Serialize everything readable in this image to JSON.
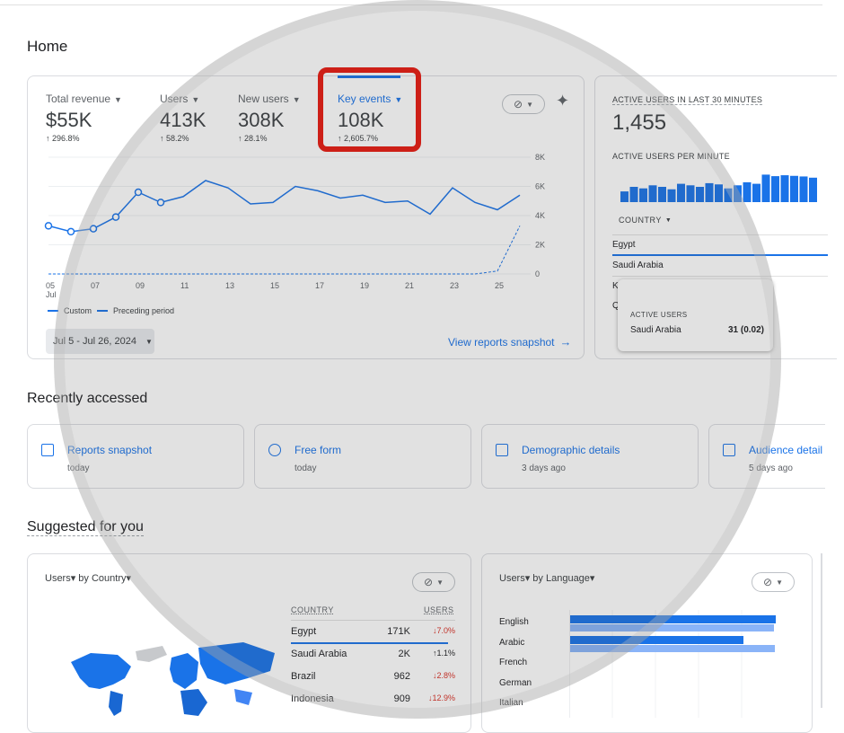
{
  "page": {
    "title": "Home"
  },
  "overview": {
    "metrics": [
      {
        "label": "Total revenue",
        "value": "$55K",
        "delta": "↑ 296.8%"
      },
      {
        "label": "Users",
        "value": "413K",
        "delta": "↑ 58.2%"
      },
      {
        "label": "New users",
        "value": "308K",
        "delta": "↑ 28.1%"
      },
      {
        "label": "Key events",
        "value": "108K",
        "delta": "↑ 2,605.7%"
      }
    ],
    "compare_label": "⊘",
    "y_ticks": [
      "8K",
      "6K",
      "4K",
      "2K",
      "0"
    ],
    "x_ticks": [
      "05",
      "07",
      "09",
      "11",
      "13",
      "15",
      "17",
      "19",
      "21",
      "23",
      "25"
    ],
    "x_month": "Jul",
    "legend_custom": "Custom",
    "legend_preceding": "Preceding period",
    "date_range": "Jul 5 - Jul 26, 2024",
    "view_snapshot": "View reports snapshot",
    "accent_color": "#1a73e8",
    "highlight_color": "#e8190f"
  },
  "realtime": {
    "title": "ACTIVE USERS IN LAST 30 MINUTES",
    "value": "1,455",
    "per_minute": "ACTIVE USERS PER MINUTE",
    "country_header": "COUNTRY",
    "countries": [
      "Egypt",
      "Saudi Arabia",
      "K",
      "Q"
    ],
    "tooltip_title": "ACTIVE USERS",
    "tooltip_country": "Saudi Arabia",
    "tooltip_value": "31 (0.02)",
    "bars": [
      0.35,
      0.5,
      0.45,
      0.55,
      0.5,
      0.42,
      0.6,
      0.55,
      0.5,
      0.62,
      0.58,
      0.45,
      0.55,
      0.65,
      0.6,
      0.9,
      0.85,
      0.88,
      0.86,
      0.84,
      0.8
    ]
  },
  "recent": {
    "title": "Recently accessed",
    "items": [
      {
        "title": "Reports snapshot",
        "sub": "today"
      },
      {
        "title": "Free form",
        "sub": "today"
      },
      {
        "title": "Demographic details",
        "sub": "3 days ago"
      },
      {
        "title": "Audience detail",
        "sub": "5 days ago"
      }
    ]
  },
  "suggested": {
    "title": "Suggested for you",
    "country_card": {
      "title": "Users▾ by Country▾",
      "col_country": "COUNTRY",
      "col_users": "USERS",
      "rows": [
        {
          "country": "Egypt",
          "users": "171K",
          "delta": "↓7.0%"
        },
        {
          "country": "Saudi Arabia",
          "users": "2K",
          "delta": "↑1.1%"
        },
        {
          "country": "Brazil",
          "users": "962",
          "delta": "↓2.8%"
        },
        {
          "country": "Indonesia",
          "users": "909",
          "delta": "↓12.9%"
        }
      ]
    },
    "language_card": {
      "title": "Users▾ by Language▾",
      "languages": [
        "English",
        "Arabic",
        "French",
        "German",
        "Italian"
      ]
    }
  },
  "chart_data": {
    "type": "line",
    "x": [
      "05",
      "06",
      "07",
      "08",
      "09",
      "10",
      "11",
      "12",
      "13",
      "14",
      "15",
      "16",
      "17",
      "18",
      "19",
      "20",
      "21",
      "22",
      "23",
      "24",
      "25",
      "26"
    ],
    "x_tick_labels": [
      "05 Jul",
      "07",
      "09",
      "11",
      "13",
      "15",
      "17",
      "19",
      "21",
      "23",
      "25"
    ],
    "series": [
      {
        "name": "Custom",
        "values": [
          3.3,
          2.9,
          3.1,
          3.9,
          5.6,
          4.9,
          5.3,
          6.4,
          5.9,
          4.8,
          4.9,
          6.0,
          5.7,
          5.2,
          5.4,
          4.9,
          5.0,
          4.1,
          5.9,
          4.9,
          4.4,
          5.4
        ]
      },
      {
        "name": "Preceding period",
        "values": [
          0,
          0,
          0,
          0,
          0,
          0,
          0,
          0,
          0,
          0,
          0,
          0,
          0,
          0,
          0,
          0,
          0,
          0,
          0,
          0,
          0.2,
          3.3
        ]
      }
    ],
    "y_ticks": [
      "8K",
      "6K",
      "4K",
      "2K",
      "0"
    ],
    "ylim": [
      0,
      8
    ]
  }
}
